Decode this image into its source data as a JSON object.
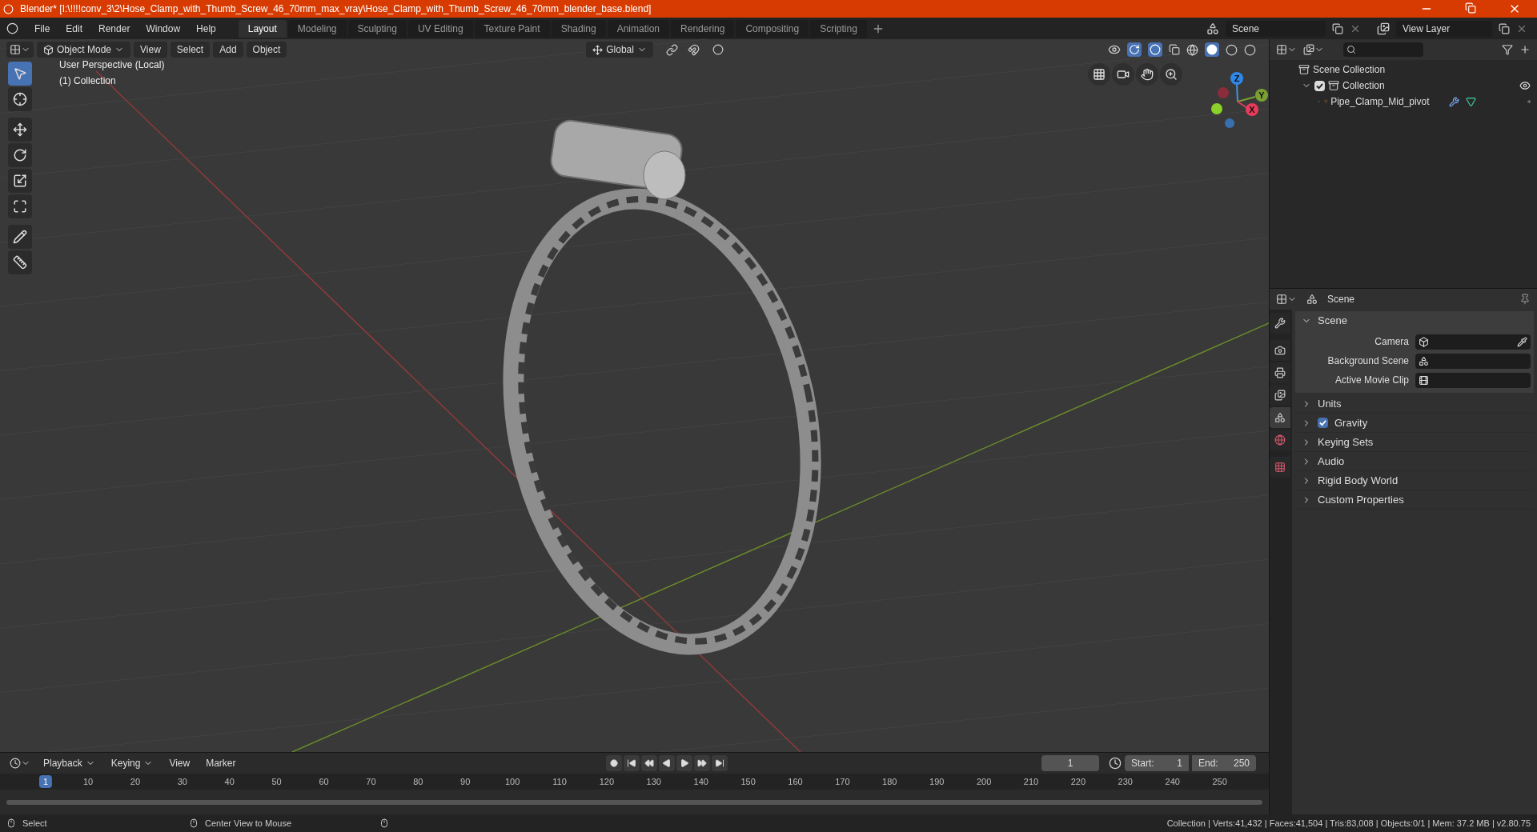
{
  "window": {
    "title": "Blender* [I:\\!!!!conv_3\\2\\Hose_Clamp_with_Thumb_Screw_46_70mm_max_vray\\Hose_Clamp_with_Thumb_Screw_46_70mm_blender_base.blend]"
  },
  "menu": [
    "File",
    "Edit",
    "Render",
    "Window",
    "Help"
  ],
  "workspaces": [
    {
      "label": "Layout",
      "selected": true
    },
    {
      "label": "Modeling",
      "selected": false
    },
    {
      "label": "Sculpting",
      "selected": false
    },
    {
      "label": "UV Editing",
      "selected": false
    },
    {
      "label": "Texture Paint",
      "selected": false
    },
    {
      "label": "Shading",
      "selected": false
    },
    {
      "label": "Animation",
      "selected": false
    },
    {
      "label": "Rendering",
      "selected": false
    },
    {
      "label": "Compositing",
      "selected": false
    },
    {
      "label": "Scripting",
      "selected": false
    }
  ],
  "scene_selector": {
    "value": "Scene"
  },
  "view_layer_selector": {
    "value": "View Layer"
  },
  "viewport": {
    "mode": "Object Mode",
    "menus": [
      "View",
      "Select",
      "Add",
      "Object"
    ],
    "transform_orientation": "Global",
    "overlay_lines": [
      "User Perspective (Local)",
      "(1) Collection"
    ],
    "gizmo_axes": [
      "Z",
      "Y",
      "X"
    ],
    "tools": [
      {
        "kind": "select",
        "selected": true
      },
      {
        "kind": "cursor",
        "selected": false
      },
      {
        "kind": "move",
        "selected": false
      },
      {
        "kind": "rotate",
        "selected": false
      },
      {
        "kind": "scale",
        "selected": false
      },
      {
        "kind": "transform",
        "selected": false
      },
      {
        "kind": "annotate",
        "selected": false
      },
      {
        "kind": "measure",
        "selected": false
      }
    ]
  },
  "outliner": {
    "items": [
      {
        "label": "Scene Collection",
        "kind": "scene",
        "children": [
          {
            "label": "Collection",
            "kind": "collection",
            "checked": true,
            "expanded": true,
            "children": [
              {
                "label": "Pipe_Clamp_Mid_pivot",
                "kind": "object",
                "expanded": false
              }
            ]
          }
        ]
      }
    ]
  },
  "properties": {
    "context": "Scene",
    "tabs": [
      {
        "kind": "tool",
        "selected": false
      },
      {
        "kind": "render",
        "selected": false
      },
      {
        "kind": "output",
        "selected": false
      },
      {
        "kind": "view_layer",
        "selected": false
      },
      {
        "kind": "scene",
        "selected": true
      },
      {
        "kind": "world",
        "selected": false
      },
      {
        "kind": "texture",
        "selected": false
      }
    ],
    "panel": {
      "title": "Scene",
      "expanded": true,
      "fields": [
        {
          "label": "Camera",
          "kind": "camera"
        },
        {
          "label": "Background Scene",
          "kind": "scene"
        },
        {
          "label": "Active Movie Clip",
          "kind": "clip"
        }
      ]
    },
    "sections": [
      {
        "label": "Units",
        "expanded": false
      },
      {
        "label": "Gravity",
        "expanded": false,
        "checked": true
      },
      {
        "label": "Keying Sets",
        "expanded": false
      },
      {
        "label": "Audio",
        "expanded": false
      },
      {
        "label": "Rigid Body World",
        "expanded": false
      },
      {
        "label": "Custom Properties",
        "expanded": false
      }
    ]
  },
  "timeline": {
    "menus": [
      "Playback",
      "Keying",
      "View",
      "Marker"
    ],
    "current_frame": "1",
    "start_label": "Start:",
    "start": "1",
    "end_label": "End:",
    "end": "250",
    "ruler": [
      {
        "label": "1",
        "selected": true
      },
      {
        "label": "10",
        "selected": false
      },
      {
        "label": "20",
        "selected": false
      },
      {
        "label": "30",
        "selected": false
      },
      {
        "label": "40",
        "selected": false
      },
      {
        "label": "50",
        "selected": false
      },
      {
        "label": "60",
        "selected": false
      },
      {
        "label": "70",
        "selected": false
      },
      {
        "label": "80",
        "selected": false
      },
      {
        "label": "90",
        "selected": false
      },
      {
        "label": "100",
        "selected": false
      },
      {
        "label": "110",
        "selected": false
      },
      {
        "label": "120",
        "selected": false
      },
      {
        "label": "130",
        "selected": false
      },
      {
        "label": "140",
        "selected": false
      },
      {
        "label": "150",
        "selected": false
      },
      {
        "label": "160",
        "selected": false
      },
      {
        "label": "170",
        "selected": false
      },
      {
        "label": "180",
        "selected": false
      },
      {
        "label": "190",
        "selected": false
      },
      {
        "label": "200",
        "selected": false
      },
      {
        "label": "210",
        "selected": false
      },
      {
        "label": "220",
        "selected": false
      },
      {
        "label": "230",
        "selected": false
      },
      {
        "label": "240",
        "selected": false
      },
      {
        "label": "250",
        "selected": false
      }
    ]
  },
  "status_bar": {
    "hints": [
      "Select",
      "Center View to Mouse"
    ],
    "stats": "Collection | Verts:41,432 | Faces:41,504 | Tris:83,008 | Objects:0/1 | Mem: 37.2 MB | v2.80.75"
  }
}
